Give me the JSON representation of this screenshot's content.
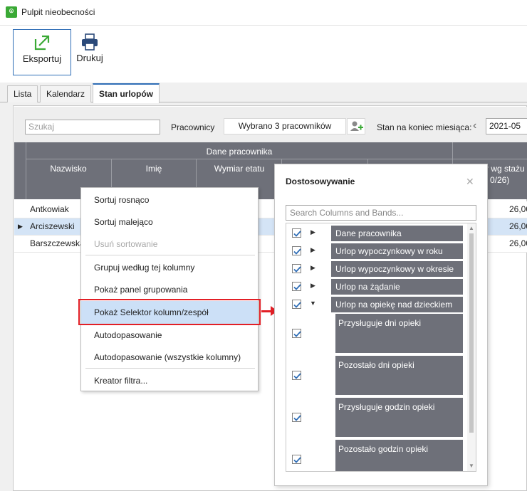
{
  "window": {
    "title": "Pulpit nieobecności",
    "icon": "app-icon"
  },
  "ribbon": {
    "export_label": "Eksportuj",
    "print_label": "Drukuj"
  },
  "tabs": [
    {
      "label": "Lista"
    },
    {
      "label": "Kalendarz"
    },
    {
      "label": "Stan urlopów",
      "active": true
    }
  ],
  "toolbar": {
    "search_placeholder": "Szukaj",
    "workers_label": "Pracownicy",
    "workers_selected": "Wybrano 3 pracowników",
    "state_label": "Stan na koniec miesiąca:",
    "month_value": "2021-05"
  },
  "grid": {
    "band": "Dane pracownika",
    "columns": [
      "Nazwisko",
      "Imię",
      "Wymiar etatu"
    ],
    "right_header_line1": "r wg stażu",
    "right_header_line2": "0/26)",
    "rows": [
      {
        "nazwisko": "Antkowiak",
        "right": "26,00"
      },
      {
        "nazwisko": "Arciszewski",
        "right": "26,00",
        "selected": true
      },
      {
        "nazwisko": "Barszczewska",
        "right": "26,00"
      }
    ]
  },
  "context_menu": {
    "items": [
      "Sortuj rosnąco",
      "Sortuj malejąco",
      "Usuń sortowanie",
      "Grupuj według tej kolumny",
      "Pokaż panel grupowania",
      "Pokaż Selektor kolumn/zespół",
      "Autodopasowanie",
      "Autodopasowanie (wszystkie kolumny)",
      "Kreator filtra..."
    ]
  },
  "dialog": {
    "title": "Dostosowywanie",
    "search_placeholder": "Search Columns and Bands...",
    "bands": [
      "Dane pracownika",
      "Urlop wypoczynkowy w roku",
      "Urlop wypoczynkowy w okresie",
      "Urlop na żądanie",
      "Urlop na opiekę nad dzieckiem"
    ],
    "columns": [
      "Przysługuje dni opieki",
      "Pozostało dni opieki",
      "Przysługuje godzin opieki",
      "Pozostało godzin opieki"
    ]
  },
  "colors": {
    "accent": "#2e6db6",
    "header": "#6e7079",
    "highlight": "#e21f26",
    "selected_row": "#d4e4f6"
  }
}
